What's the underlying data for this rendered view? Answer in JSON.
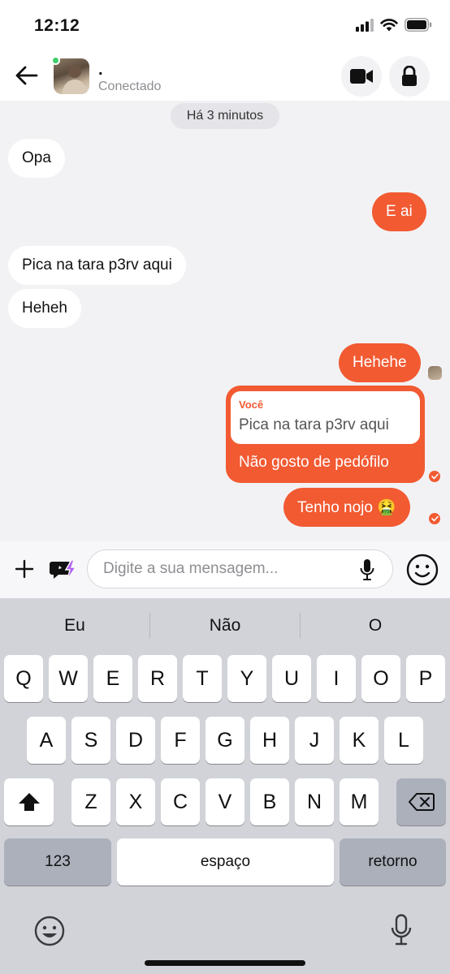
{
  "status_bar": {
    "time": "12:12"
  },
  "header": {
    "contact_name": ".",
    "contact_status": "Conectado"
  },
  "chat": {
    "timestamp": "Há 3 minutos",
    "messages": [
      {
        "from": "them",
        "text": "Opa"
      },
      {
        "from": "me",
        "text": "E ai"
      },
      {
        "from": "them",
        "text": "Pica na tara p3rv aqui"
      },
      {
        "from": "them",
        "text": "Heheh"
      },
      {
        "from": "me",
        "text": "Hehehe"
      },
      {
        "from": "me",
        "reply_author": "Você",
        "reply_text": "Pica na tara p3rv aqui",
        "text": "Não gosto de pedófilo"
      },
      {
        "from": "me",
        "text": "Tenho nojo 🤮"
      }
    ]
  },
  "composer": {
    "placeholder": "Digite a sua mensagem..."
  },
  "keyboard": {
    "suggestions": [
      "Eu",
      "Não",
      "O"
    ],
    "row1": [
      "Q",
      "W",
      "E",
      "R",
      "T",
      "Y",
      "U",
      "I",
      "O",
      "P"
    ],
    "row2": [
      "A",
      "S",
      "D",
      "F",
      "G",
      "H",
      "J",
      "K",
      "L"
    ],
    "row3": [
      "Z",
      "X",
      "C",
      "V",
      "B",
      "N",
      "M"
    ],
    "numbers_label": "123",
    "space_label": "espaço",
    "return_label": "retorno"
  },
  "colors": {
    "accent": "#f25a32",
    "chat_bg": "#f2f2f4",
    "online": "#3fcf6b"
  }
}
